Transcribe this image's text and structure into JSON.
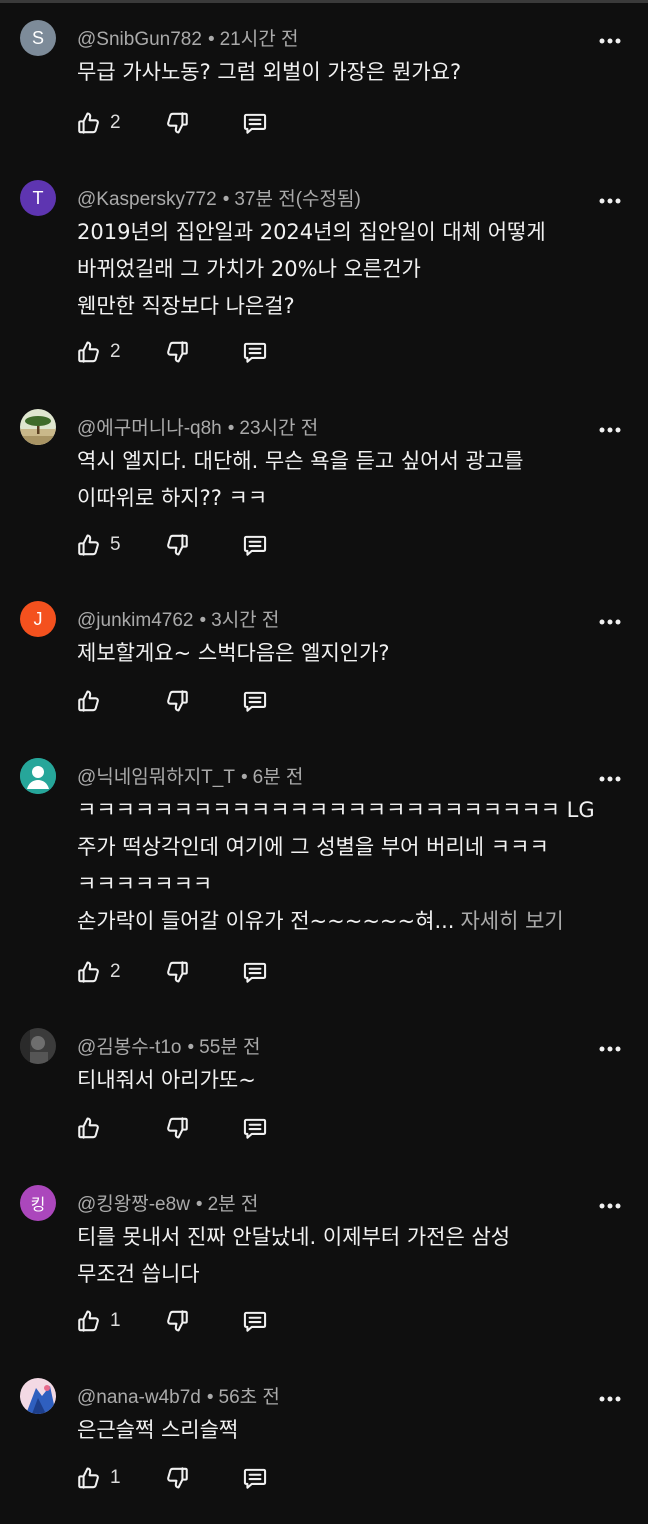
{
  "icons": {
    "like": "thumb-up-icon",
    "dislike": "thumb-down-icon",
    "reply": "reply-icon",
    "more": "more-vertical-icon"
  },
  "colors": {
    "background": "#0f0f0f",
    "meta_text": "#aaaaaa",
    "body_text": "#f1f1f1"
  },
  "comments": [
    {
      "author": "@SnibGun782",
      "separator": "•",
      "time": "21시간 전",
      "avatar_letter": "S",
      "avatar_color": "#7d8b99",
      "lines": [
        "무급 가사노동? 그럼 외벌이 가장은 뭔가요?"
      ],
      "likes": "2"
    },
    {
      "author": "@Kaspersky772",
      "separator": "•",
      "time": "37분 전(수정됨)",
      "avatar_letter": "T",
      "avatar_color": "#5e35b1",
      "lines": [
        "2019년의 집안일과 2024년의 집안일이 대체 어떻게",
        "바뀌었길래 그 가치가 20%나 오른건가",
        "웬만한 직장보다 나은걸?"
      ],
      "likes": "2"
    },
    {
      "author": "@에구머니나-q8h",
      "separator": "•",
      "time": "23시간 전",
      "avatar_image": "tree-landscape-avatar",
      "lines": [
        "역시 엘지다. 대단해. 무슨 욕을 듣고 싶어서 광고를",
        "이따위로 하지?? ㅋㅋ"
      ],
      "likes": "5"
    },
    {
      "author": "@junkim4762",
      "separator": "•",
      "time": "3시간 전",
      "avatar_letter": "J",
      "avatar_color": "#f4511e",
      "lines": [
        "제보할게요~ 스벅다음은 엘지인가?"
      ],
      "likes": ""
    },
    {
      "author": "@닉네임뭐하지T_T",
      "separator": "•",
      "time": "6분 전",
      "avatar_image": "default-person-avatar",
      "avatar_color": "#26a69a",
      "lines": [
        "ㅋㅋㅋㅋㅋㅋㅋㅋㅋㅋㅋㅋㅋㅋㅋㅋㅋㅋㅋㅋㅋㅋㅋㅋㅋ LG",
        "주가 떡상각인데 여기에 그 성별을 부어 버리네 ㅋㅋㅋ",
        "ㅋㅋㅋㅋㅋㅋㅋ",
        "손가락이 들어갈 이유가 전~~~~~~혀..."
      ],
      "read_more": "자세히 보기",
      "likes": "2"
    },
    {
      "author": "@김봉수-t1o",
      "separator": "•",
      "time": "55분 전",
      "avatar_image": "dark-photo-avatar",
      "lines": [
        "티내줘서 아리가또~"
      ],
      "likes": ""
    },
    {
      "author": "@킹왕짱-e8w",
      "separator": "•",
      "time": "2분 전",
      "avatar_letter": "킹",
      "avatar_color": "#ab47bc",
      "lines": [
        "티를 못내서 진짜 안달났네. 이제부터 가전은 삼성",
        "무조건 씁니다"
      ],
      "likes": "1"
    },
    {
      "author": "@nana-w4b7d",
      "separator": "•",
      "time": "56초 전",
      "avatar_image": "blue-illustration-avatar",
      "lines": [
        "은근슬쩍 스리슬쩍"
      ],
      "likes": "1"
    }
  ]
}
